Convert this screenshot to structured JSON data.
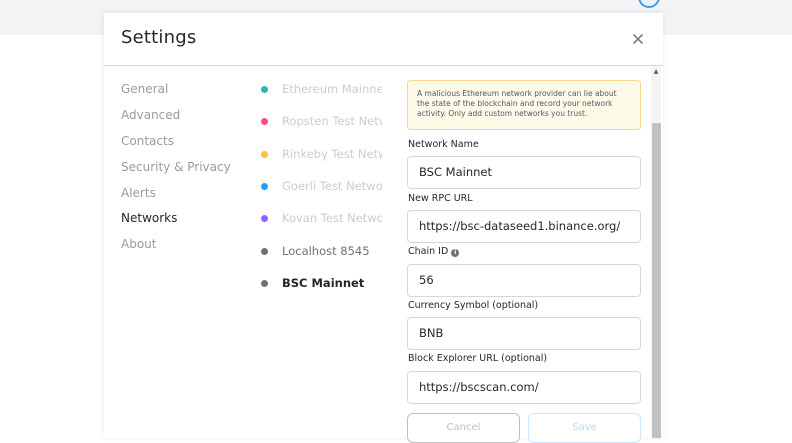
{
  "modal": {
    "title": "Settings"
  },
  "sidebar": {
    "items": [
      {
        "label": "General",
        "active": false
      },
      {
        "label": "Advanced",
        "active": false
      },
      {
        "label": "Contacts",
        "active": false
      },
      {
        "label": "Security & Privacy",
        "active": false
      },
      {
        "label": "Alerts",
        "active": false
      },
      {
        "label": "Networks",
        "active": true
      },
      {
        "label": "About",
        "active": false
      }
    ]
  },
  "networks": {
    "items": [
      {
        "label": "Ethereum Mainnet...",
        "color": "#29b6af"
      },
      {
        "label": "Ropsten Test Netw...",
        "color": "#ff4a8d"
      },
      {
        "label": "Rinkeby Test Netw...",
        "color": "#f6c343"
      },
      {
        "label": "Goerli Test Networ...",
        "color": "#3099f2"
      },
      {
        "label": "Kovan Test Networ...",
        "color": "#9064ff"
      },
      {
        "label": "Localhost 8545",
        "color": "#6a737d"
      },
      {
        "label": "BSC Mainnet",
        "color": "#6a737d"
      }
    ]
  },
  "form": {
    "warning": "A malicious Ethereum network provider can lie about the state of the blockchain and record your network activity. Only add custom networks you trust.",
    "network_name": {
      "label": "Network Name",
      "value": "BSC Mainnet"
    },
    "rpc_url": {
      "label": "New RPC URL",
      "value": "https://bsc-dataseed1.binance.org/"
    },
    "chain_id": {
      "label": "Chain ID",
      "value": "56",
      "info_icon": "info-icon"
    },
    "currency_symbol": {
      "label": "Currency Symbol (optional)",
      "value": "BNB"
    },
    "block_explorer": {
      "label": "Block Explorer URL (optional)",
      "value": "https://bscscan.com/"
    },
    "cancel_label": "Cancel",
    "save_label": "Save"
  }
}
